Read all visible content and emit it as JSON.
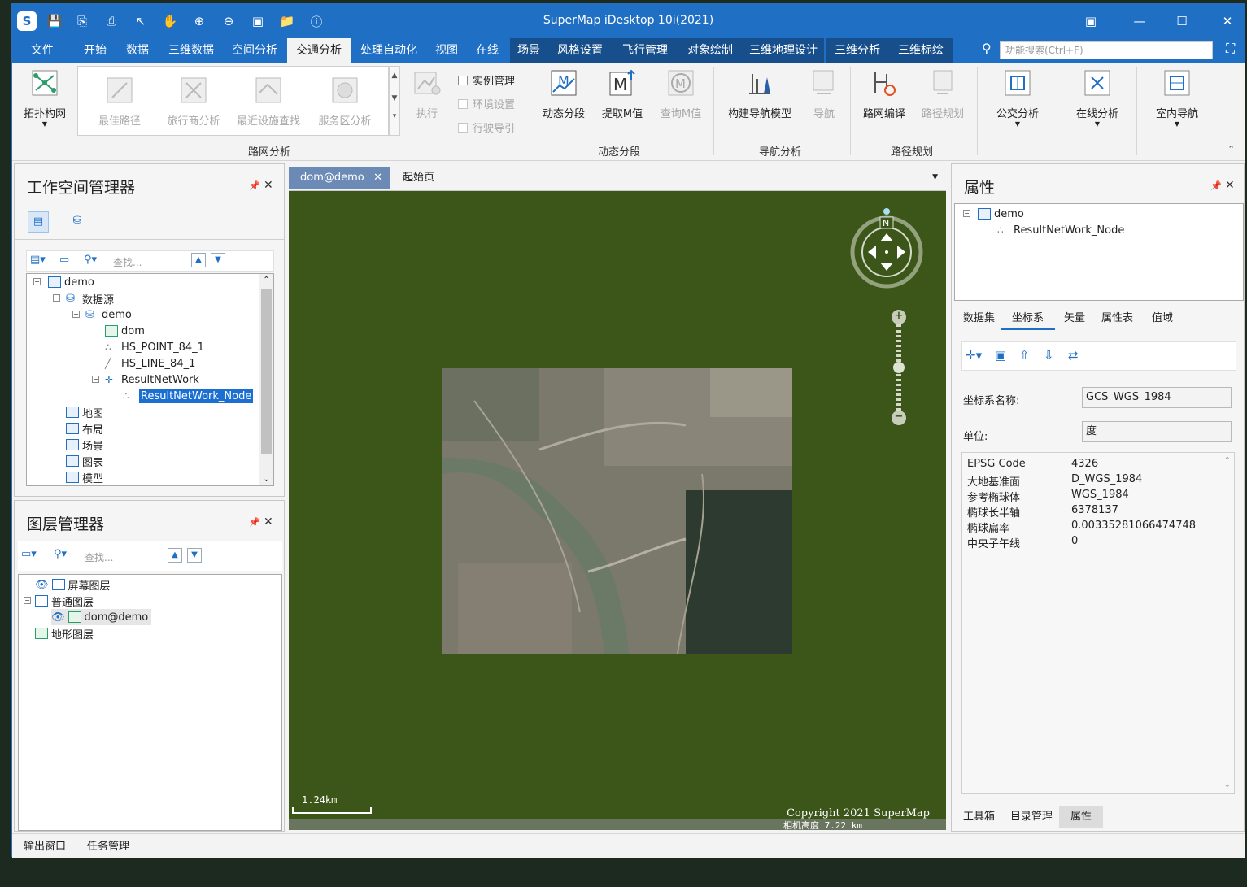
{
  "window": {
    "title": "SuperMap iDesktop 10i(2021)"
  },
  "menus": [
    "文件",
    "开始",
    "数据",
    "三维数据",
    "空间分析",
    "交通分析",
    "处理自动化",
    "视图",
    "在线",
    "场景",
    "风格设置",
    "飞行管理",
    "对象绘制",
    "三维地理设计",
    "三维分析",
    "三维标绘"
  ],
  "search": {
    "placeholder": "功能搜索(Ctrl+F)"
  },
  "ribbon": {
    "topology": "拓扑构网",
    "gallery": [
      "最佳路径",
      "旅行商分析",
      "最近设施查找",
      "服务区分析"
    ],
    "execute": "执行",
    "checks": [
      "实例管理",
      "环境设置",
      "行驶导引"
    ],
    "group_network": "路网分析",
    "dyn_seg": "动态分段",
    "extract_m": "提取M值",
    "query_m": "查询M值",
    "group_dyn": "动态分段",
    "build_nav": "构建导航模型",
    "navigate": "导航",
    "group_nav": "导航分析",
    "compile": "路网编译",
    "route_plan": "路径规划",
    "group_route": "路径规划",
    "transit": "公交分析",
    "online": "在线分析",
    "indoor": "室内导航"
  },
  "workspace": {
    "title": "工作空间管理器",
    "find_placeholder": "查找...",
    "tree": {
      "root": "demo",
      "datasources": "数据源",
      "ds": "demo",
      "items": [
        "dom",
        "HS_POINT_84_1",
        "HS_LINE_84_1",
        "ResultNetWork",
        "ResultNetWork_Node"
      ],
      "others": [
        "地图",
        "布局",
        "场景",
        "图表",
        "模型"
      ]
    }
  },
  "layers": {
    "title": "图层管理器",
    "find_placeholder": "查找...",
    "items": [
      "屏幕图层",
      "普通图层",
      "dom@demo",
      "地形图层"
    ]
  },
  "map": {
    "tabs": [
      "dom@demo",
      "起始页"
    ],
    "scale": "1.24km",
    "copyright": "Copyright 2021 SuperMap",
    "camera": "相机高度 7.22 km",
    "compass_n": "N"
  },
  "properties": {
    "title": "属性",
    "tree_root": "demo",
    "tree_child": "ResultNetWork_Node",
    "tabs": [
      "数据集",
      "坐标系",
      "矢量",
      "属性表",
      "值域"
    ],
    "name_label": "坐标系名称:",
    "name_value": "GCS_WGS_1984",
    "unit_label": "单位:",
    "unit_value": "度",
    "rows": [
      [
        "EPSG Code",
        "4326"
      ],
      [
        "大地基准面",
        "D_WGS_1984"
      ],
      [
        "参考椭球体",
        "WGS_1984"
      ],
      [
        "椭球长半轴",
        "6378137"
      ],
      [
        "椭球扁率",
        "0.00335281066474748"
      ],
      [
        "中央子午线",
        "0"
      ]
    ],
    "bottom_tabs": [
      "工具箱",
      "目录管理",
      "属性"
    ]
  },
  "status": {
    "output": "输出窗口",
    "tasks": "任务管理"
  },
  "colors": {
    "accent": "#1f6fc5",
    "map_bg": "#3c5519",
    "select": "#1a6fd1"
  }
}
